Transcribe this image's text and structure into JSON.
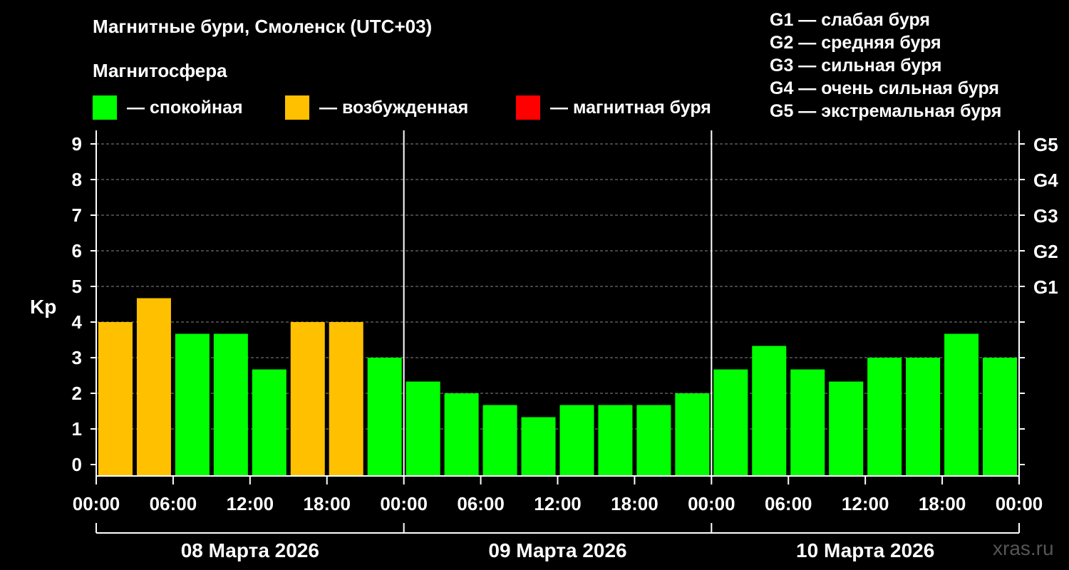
{
  "title": "Магнитные бури, Смоленск (UTC+03)",
  "magnetosphere_label": "Магнитосфера",
  "colors": {
    "calm": "#00ff00",
    "excited": "#ffc000",
    "storm": "#ff0000",
    "background": "#000000",
    "text": "#ffffff",
    "watermark": "#555555"
  },
  "legend": [
    {
      "label": "— спокойная",
      "color": "#00ff00"
    },
    {
      "label": "— возбужденная",
      "color": "#ffc000"
    },
    {
      "label": "— магнитная буря",
      "color": "#ff0000"
    }
  ],
  "storm_levels": [
    "G1 — слабая буря",
    "G2 — средняя буря",
    "G3 — сильная буря",
    "G4 — очень сильная буря",
    "G5 — экстремальная буря"
  ],
  "watermark": "xras.ru",
  "chart_data": {
    "type": "bar",
    "ylabel": "Kp",
    "ylim": [
      0,
      9
    ],
    "yticks": [
      "0",
      "1",
      "2",
      "3",
      "4",
      "5",
      "6",
      "7",
      "8",
      "9"
    ],
    "right_ticks": [
      {
        "value": 5,
        "label": "G1"
      },
      {
        "value": 6,
        "label": "G2"
      },
      {
        "value": 7,
        "label": "G3"
      },
      {
        "value": 8,
        "label": "G4"
      },
      {
        "value": 9,
        "label": "G5"
      }
    ],
    "grid": true,
    "xticks": [
      "00:00",
      "06:00",
      "12:00",
      "18:00",
      "00:00",
      "06:00",
      "12:00",
      "18:00",
      "00:00",
      "06:00",
      "12:00",
      "18:00",
      "00:00"
    ],
    "days": [
      "08 Марта 2026",
      "09 Марта 2026",
      "10 Марта 2026"
    ],
    "values": [
      4.0,
      4.67,
      3.67,
      3.67,
      2.67,
      4.0,
      4.0,
      3.0,
      2.33,
      2.0,
      1.67,
      1.33,
      1.67,
      1.67,
      1.67,
      2.0,
      2.67,
      3.33,
      2.67,
      2.33,
      3.0,
      3.0,
      3.67,
      3.0
    ],
    "levels": [
      "excited",
      "excited",
      "calm",
      "calm",
      "calm",
      "excited",
      "excited",
      "calm",
      "calm",
      "calm",
      "calm",
      "calm",
      "calm",
      "calm",
      "calm",
      "calm",
      "calm",
      "calm",
      "calm",
      "calm",
      "calm",
      "calm",
      "calm",
      "calm"
    ]
  }
}
